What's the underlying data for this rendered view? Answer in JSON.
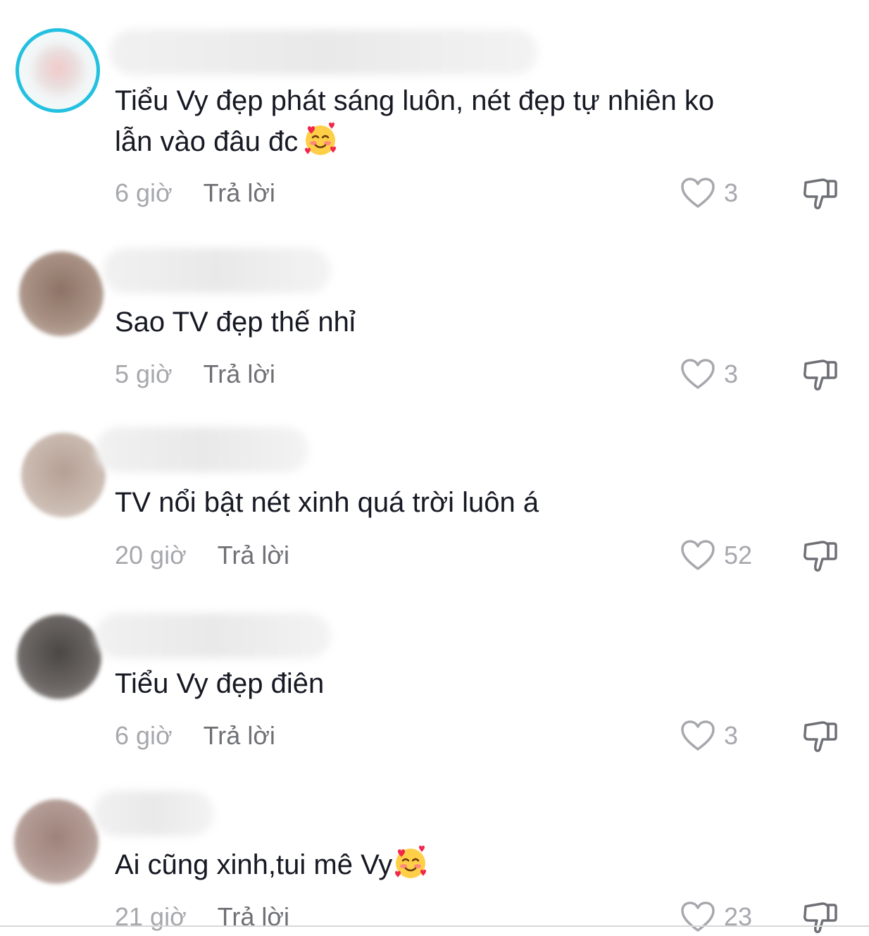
{
  "reply_label": "Trả lời",
  "colors": {
    "text": "#161823",
    "muted": "#a7a8ad",
    "reply": "#6f7076",
    "avatar_ring": "#23c0e0"
  },
  "comments": [
    {
      "text_line1": "Tiểu Vy đẹp phát sáng luôn, nét đẹp tự nhiên ko",
      "text_line2": "lẫn vào đâu đc",
      "emoji": "smiling-face-with-hearts",
      "time": "6 giờ",
      "likes": "3"
    },
    {
      "text_line1": "Sao TV đẹp thế nhỉ",
      "time": "5 giờ",
      "likes": "3"
    },
    {
      "text_line1": "TV nổi bật nét xinh quá trời luôn á",
      "time": "20 giờ",
      "likes": "52"
    },
    {
      "text_line1": "Tiểu Vy đẹp điên",
      "time": "6 giờ",
      "likes": "3"
    },
    {
      "text_line1": "Ai cũng xinh,tui mê Vy",
      "emoji": "smiling-face-with-hearts",
      "time": "21 giờ",
      "likes": "23"
    }
  ]
}
